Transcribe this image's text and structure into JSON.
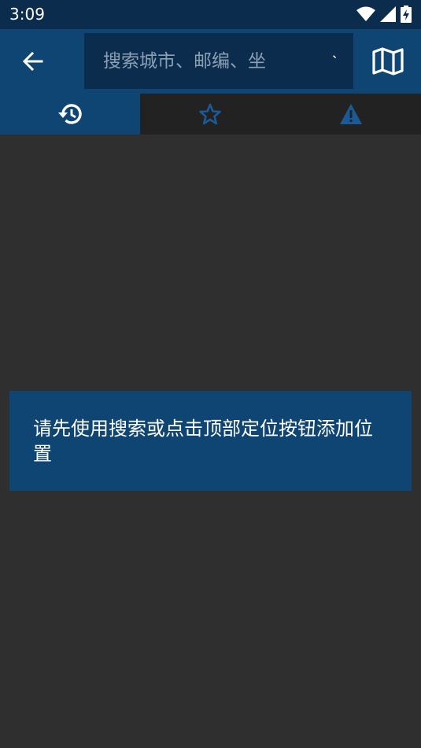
{
  "status_bar": {
    "time": "3:09",
    "icons": [
      "wifi-icon",
      "signal-icon",
      "battery-charging-icon"
    ]
  },
  "app_bar": {
    "back_icon": "arrow-left-icon",
    "search": {
      "placeholder": "搜索城市、邮编、坐",
      "value": ""
    },
    "locate_label": "˴",
    "map_icon": "map-icon"
  },
  "tabs": [
    {
      "name": "history",
      "icon": "history-icon",
      "active": true
    },
    {
      "name": "favorites",
      "icon": "star-icon",
      "active": false
    },
    {
      "name": "alerts",
      "icon": "warning-icon",
      "active": false
    }
  ],
  "message": {
    "text": "请先使用搜索或点击顶部定位按钮添加位置"
  },
  "colors": {
    "status_bar": "#0c2c4d",
    "app_bar": "#0f4573",
    "search_bg": "#0c2c4d",
    "tab_bar": "#222222",
    "background": "#2f2f2f",
    "accent_icon": "#1a5a96"
  }
}
